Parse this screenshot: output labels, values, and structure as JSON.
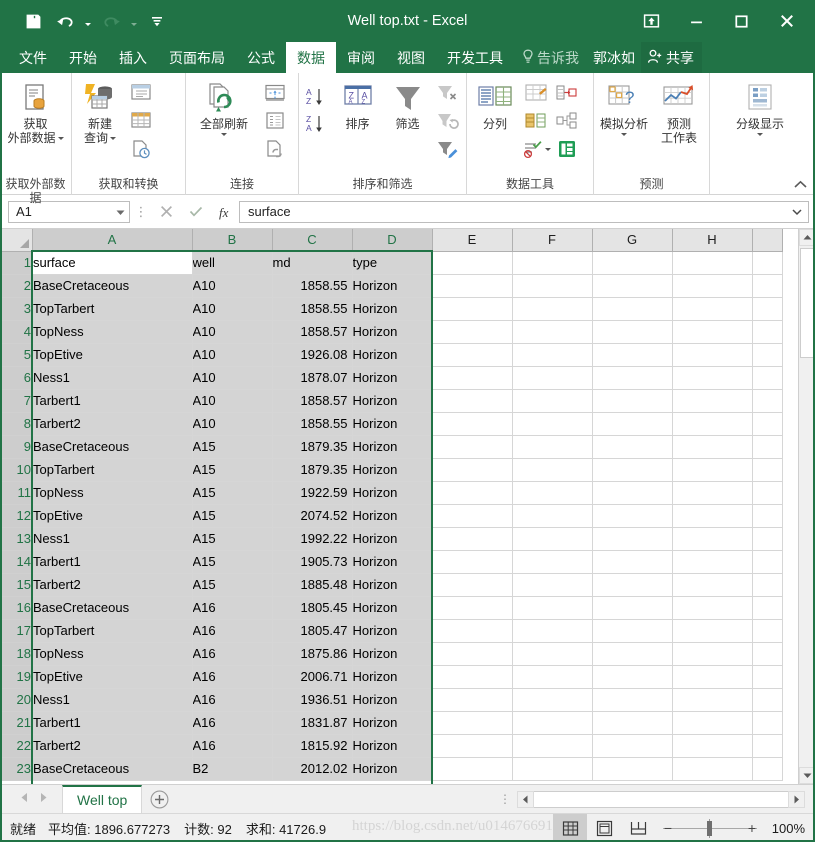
{
  "window": {
    "title": "Well top.txt - Excel",
    "quick_access": [
      {
        "name": "save",
        "icon": "save-icon"
      },
      {
        "name": "undo",
        "icon": "undo-icon"
      },
      {
        "name": "redo",
        "icon": "redo-icon"
      },
      {
        "name": "customize",
        "icon": "customize-quick-access-icon"
      }
    ],
    "ribbon_display_options": "ribbon-display-options-icon",
    "minimize": "minimize-icon",
    "restore": "restore-icon",
    "close": "close-icon"
  },
  "tabs": [
    {
      "label": "文件",
      "active": false
    },
    {
      "label": "开始",
      "active": false
    },
    {
      "label": "插入",
      "active": false
    },
    {
      "label": "页面布局",
      "active": false
    },
    {
      "label": "公式",
      "active": false
    },
    {
      "label": "数据",
      "active": true
    },
    {
      "label": "审阅",
      "active": false
    },
    {
      "label": "视图",
      "active": false
    },
    {
      "label": "开发工具",
      "active": false
    }
  ],
  "tellme": "告诉我",
  "user": "郭冰如",
  "share": "共享",
  "ribbon": {
    "groups": [
      {
        "label": "获取和转换",
        "label2": "获取外部数据",
        "items": [
          {
            "label": "获取\n外部数据",
            "name": "get-external-data-button"
          },
          {
            "label": "新建\n查询",
            "name": "new-query-button"
          }
        ]
      },
      {
        "label": "连接",
        "items": [
          {
            "label": "全部刷新",
            "name": "refresh-all-button"
          }
        ]
      },
      {
        "label": "排序和筛选",
        "items": [
          {
            "label": "排序",
            "name": "sort-button"
          },
          {
            "label": "筛选",
            "name": "filter-button"
          }
        ]
      },
      {
        "label": "数据工具",
        "items": [
          {
            "label": "分列",
            "name": "text-to-columns-button"
          }
        ]
      },
      {
        "label": "预测",
        "items": [
          {
            "label": "模拟分析",
            "name": "what-if-analysis-button"
          },
          {
            "label": "预测\n工作表",
            "name": "forecast-sheet-button"
          }
        ]
      },
      {
        "label": "",
        "items": [
          {
            "label": "分级显示",
            "name": "outline-button"
          }
        ]
      }
    ],
    "group_labels": {
      "get_external_data": "获取外部数据",
      "get_and_transform": "获取和转换",
      "connections": "连接",
      "sort_filter": "排序和筛选",
      "data_tools": "数据工具",
      "forecast": "预测"
    },
    "buttons": {
      "get_external_data_l1": "获取",
      "get_external_data_l2": "外部数据",
      "new_query_l1": "新建",
      "new_query_l2": "查询",
      "refresh_all": "全部刷新",
      "sort": "排序",
      "filter": "筛选",
      "text_to_columns": "分列",
      "what_if": "模拟分析",
      "forecast_sheet_l1": "预测",
      "forecast_sheet_l2": "工作表",
      "outline": "分级显示"
    }
  },
  "formula_bar": {
    "name_box": "A1",
    "value": "surface",
    "cancel_icon": "cancel-icon",
    "enter_icon": "enter-icon",
    "fx_icon": "insert-function-icon"
  },
  "sheet": {
    "columns": [
      {
        "label": "A",
        "width": 160,
        "selected": true
      },
      {
        "label": "B",
        "width": 80,
        "selected": true
      },
      {
        "label": "C",
        "width": 80,
        "selected": true
      },
      {
        "label": "D",
        "width": 80,
        "selected": true
      },
      {
        "label": "E",
        "width": 80,
        "selected": false
      },
      {
        "label": "F",
        "width": 80,
        "selected": false
      },
      {
        "label": "G",
        "width": 80,
        "selected": false
      },
      {
        "label": "H",
        "width": 80,
        "selected": false
      },
      {
        "label": "",
        "width": 30,
        "selected": false
      }
    ],
    "header_row": [
      "surface",
      "well",
      "md",
      "type"
    ],
    "rows": [
      {
        "n": "1",
        "cells": [
          "surface",
          "well",
          "md",
          "type"
        ],
        "header": true
      },
      {
        "n": "2",
        "cells": [
          "BaseCretaceous",
          "A10",
          "1858.55",
          "Horizon"
        ]
      },
      {
        "n": "3",
        "cells": [
          "TopTarbert",
          "A10",
          "1858.55",
          "Horizon"
        ]
      },
      {
        "n": "4",
        "cells": [
          "TopNess",
          "A10",
          "1858.57",
          "Horizon"
        ]
      },
      {
        "n": "5",
        "cells": [
          "TopEtive",
          "A10",
          "1926.08",
          "Horizon"
        ]
      },
      {
        "n": "6",
        "cells": [
          "Ness1",
          "A10",
          "1878.07",
          "Horizon"
        ]
      },
      {
        "n": "7",
        "cells": [
          "Tarbert1",
          "A10",
          "1858.57",
          "Horizon"
        ]
      },
      {
        "n": "8",
        "cells": [
          "Tarbert2",
          "A10",
          "1858.55",
          "Horizon"
        ]
      },
      {
        "n": "9",
        "cells": [
          "BaseCretaceous",
          "A15",
          "1879.35",
          "Horizon"
        ]
      },
      {
        "n": "10",
        "cells": [
          "TopTarbert",
          "A15",
          "1879.35",
          "Horizon"
        ]
      },
      {
        "n": "11",
        "cells": [
          "TopNess",
          "A15",
          "1922.59",
          "Horizon"
        ]
      },
      {
        "n": "12",
        "cells": [
          "TopEtive",
          "A15",
          "2074.52",
          "Horizon"
        ]
      },
      {
        "n": "13",
        "cells": [
          "Ness1",
          "A15",
          "1992.22",
          "Horizon"
        ]
      },
      {
        "n": "14",
        "cells": [
          "Tarbert1",
          "A15",
          "1905.73",
          "Horizon"
        ]
      },
      {
        "n": "15",
        "cells": [
          "Tarbert2",
          "A15",
          "1885.48",
          "Horizon"
        ]
      },
      {
        "n": "16",
        "cells": [
          "BaseCretaceous",
          "A16",
          "1805.45",
          "Horizon"
        ]
      },
      {
        "n": "17",
        "cells": [
          "TopTarbert",
          "A16",
          "1805.47",
          "Horizon"
        ]
      },
      {
        "n": "18",
        "cells": [
          "TopNess",
          "A16",
          "1875.86",
          "Horizon"
        ]
      },
      {
        "n": "19",
        "cells": [
          "TopEtive",
          "A16",
          "2006.71",
          "Horizon"
        ]
      },
      {
        "n": "20",
        "cells": [
          "Ness1",
          "A16",
          "1936.51",
          "Horizon"
        ]
      },
      {
        "n": "21",
        "cells": [
          "Tarbert1",
          "A16",
          "1831.87",
          "Horizon"
        ]
      },
      {
        "n": "22",
        "cells": [
          "Tarbert2",
          "A16",
          "1815.92",
          "Horizon"
        ]
      },
      {
        "n": "23",
        "cells": [
          "BaseCretaceous",
          "B2",
          "2012.02",
          "Horizon"
        ],
        "clipped": true
      }
    ],
    "active_cell": "A1",
    "selection_range": "A1:D23"
  },
  "sheet_tabs": {
    "tabs": [
      {
        "label": "Well top",
        "active": true
      }
    ],
    "add_sheet": "add-sheet-icon",
    "prev": "prev-sheet-icon",
    "next": "next-sheet-icon"
  },
  "status_bar": {
    "state": "就绪",
    "average": "平均值: 1896.677273",
    "count": "计数: 92",
    "sum": "求和: 41726.9",
    "views": [
      {
        "name": "normal-view-button",
        "active": true
      },
      {
        "name": "page-layout-view-button",
        "active": false
      },
      {
        "name": "page-break-preview-button",
        "active": false
      }
    ],
    "zoom": "100%",
    "zoom_out": "−",
    "zoom_in": "+"
  },
  "watermark": "https://blog.csdn.net/u014676691",
  "colors": {
    "brand": "#217346",
    "ribbon_bg": "#ffffff",
    "selection": "#d4d4d4",
    "header": "#e4e4e4"
  }
}
